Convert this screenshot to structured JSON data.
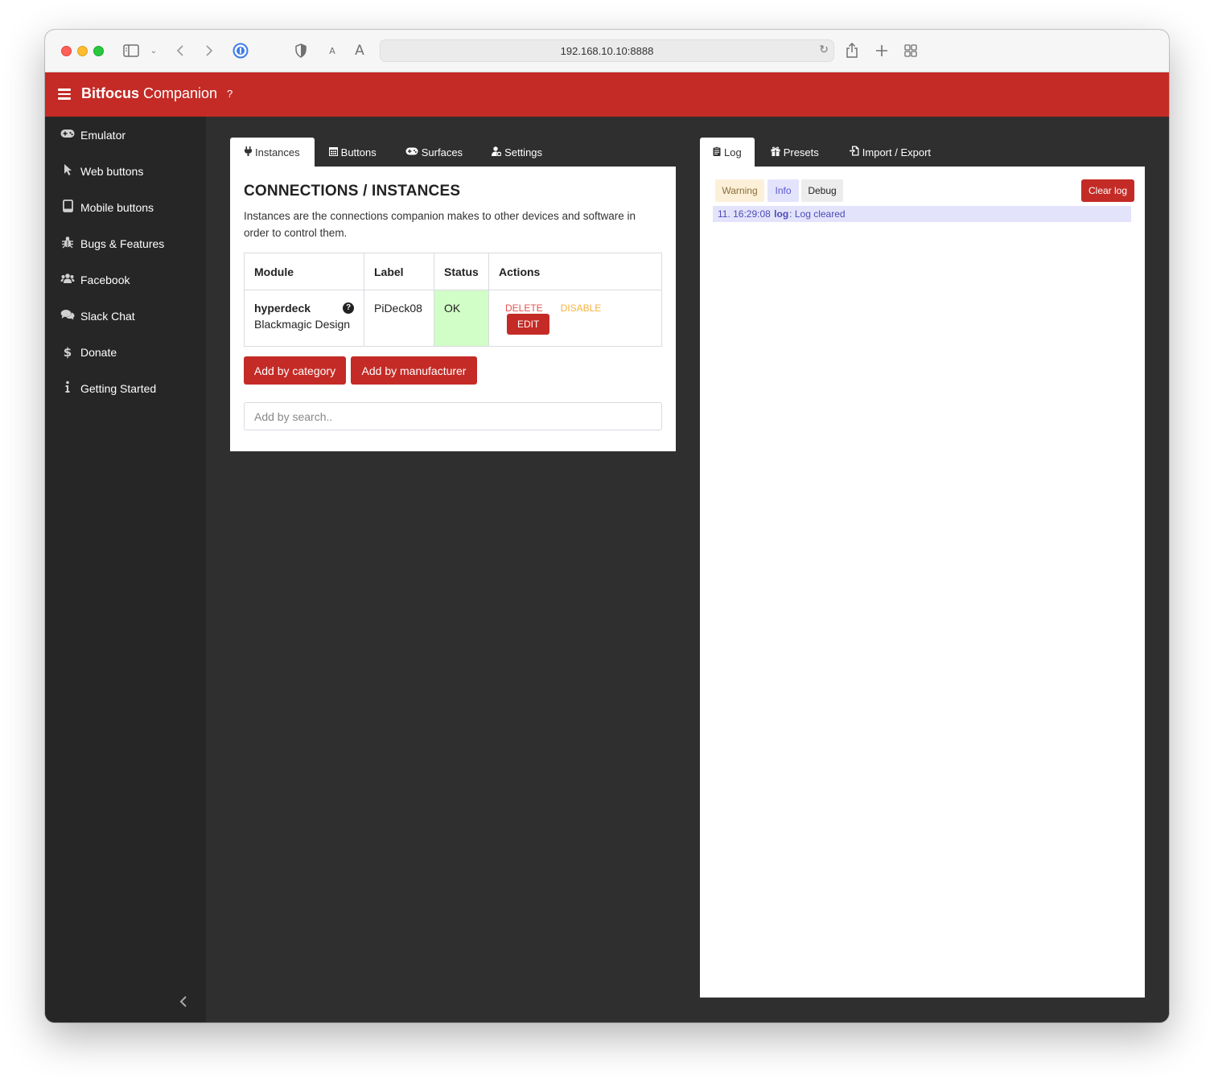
{
  "browser": {
    "url": "192.168.10.10:8888",
    "icons": [
      "sidebar-toggle-icon",
      "chevron-down-icon",
      "back-icon",
      "forward-icon",
      "password-manager-icon",
      "shield-icon",
      "text-smaller-icon",
      "text-larger-icon",
      "reload-icon",
      "share-icon",
      "new-tab-icon",
      "tab-overview-icon"
    ],
    "text_small": "A",
    "text_large": "A"
  },
  "header": {
    "brand_bold": "Bitfocus",
    "brand_rest": " Companion",
    "help": "?"
  },
  "sidebar": {
    "items": [
      {
        "label": "Emulator",
        "icon": "gamepad-icon"
      },
      {
        "label": "Web buttons",
        "icon": "pointer-icon"
      },
      {
        "label": "Mobile buttons",
        "icon": "tablet-icon"
      },
      {
        "label": "Bugs & Features",
        "icon": "bug-icon"
      },
      {
        "label": "Facebook",
        "icon": "users-icon"
      },
      {
        "label": "Slack Chat",
        "icon": "comments-icon"
      },
      {
        "label": "Donate",
        "icon": "dollar-icon"
      },
      {
        "label": "Getting Started",
        "icon": "info-icon"
      }
    ]
  },
  "left_tabs": [
    {
      "label": "Instances",
      "icon": "plug-icon",
      "active": true
    },
    {
      "label": "Buttons",
      "icon": "calendar-icon",
      "active": false
    },
    {
      "label": "Surfaces",
      "icon": "gamepad-icon",
      "active": false
    },
    {
      "label": "Settings",
      "icon": "user-cog-icon",
      "active": false
    }
  ],
  "instances": {
    "title": "CONNECTIONS / INSTANCES",
    "description": "Instances are the connections companion makes to other devices and software in order to control them.",
    "columns": [
      "Module",
      "Label",
      "Status",
      "Actions"
    ],
    "rows": [
      {
        "module": "hyperdeck",
        "manufacturer": "Blackmagic Design",
        "label": "PiDeck08",
        "status": "OK",
        "actions": {
          "delete": "DELETE",
          "disable": "DISABLE",
          "edit": "EDIT"
        }
      }
    ],
    "add_by_category": "Add by category",
    "add_by_manufacturer": "Add by manufacturer",
    "search_placeholder": "Add by search.."
  },
  "right_tabs": [
    {
      "label": "Log",
      "icon": "clipboard-icon",
      "active": true
    },
    {
      "label": "Presets",
      "icon": "gift-icon",
      "active": false
    },
    {
      "label": "Import / Export",
      "icon": "file-import-icon",
      "active": false
    }
  ],
  "log": {
    "levels": {
      "warning": "Warning",
      "info": "Info",
      "debug": "Debug"
    },
    "clear": "Clear log",
    "entries": [
      {
        "prefix": "11. 16:29:08 ",
        "source": "log",
        "message": ": Log cleared"
      }
    ]
  },
  "colors": {
    "brand_red": "#c42b26",
    "sidebar_bg": "#262626",
    "main_bg": "#2f2f2f",
    "status_ok_bg": "#d1fdc6"
  }
}
